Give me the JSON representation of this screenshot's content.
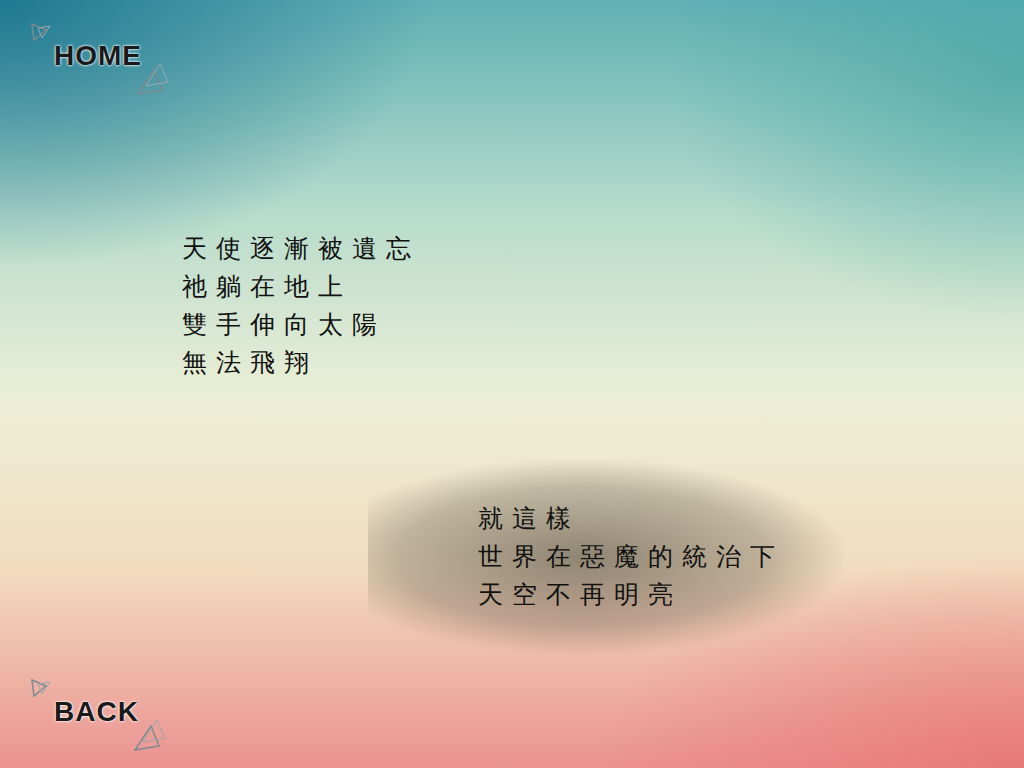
{
  "nav": {
    "home": "HOME",
    "back": "BACK"
  },
  "passages": [
    {
      "kind": "plain",
      "lines": [
        "天使逐漸被遺忘",
        "祂躺在地上",
        "雙手伸向太陽",
        "無法飛翔"
      ]
    },
    {
      "kind": "shaded",
      "lines": [
        "就這樣",
        "世界在惡魔的統治下",
        "天空不再明亮"
      ]
    }
  ]
}
